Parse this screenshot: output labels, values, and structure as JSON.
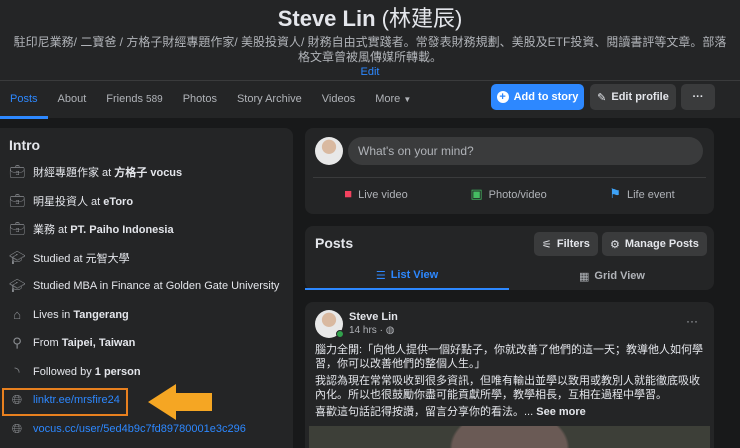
{
  "profile": {
    "name": "Steve Lin",
    "name_cn": "(林建辰)",
    "bio": "駐印尼業務/ 二寶爸 / 方格子財經專題作家/ 美股投資人/ 財務自由式實踐者。常發表財務規劃、美股及ETF投資、閱讀書評等文章。部落格文章曾被風傳媒所轉載。",
    "edit_label": "Edit"
  },
  "nav": {
    "tabs": [
      {
        "label": "Posts"
      },
      {
        "label": "About"
      },
      {
        "label": "Friends",
        "count": "589"
      },
      {
        "label": "Photos"
      },
      {
        "label": "Story Archive"
      },
      {
        "label": "Videos"
      },
      {
        "label": "More"
      }
    ],
    "add_story": "Add to story",
    "edit_profile": "Edit profile",
    "more_dots": "···"
  },
  "intro": {
    "title": "Intro",
    "items": [
      {
        "icon": "briefcase",
        "pre": "財經專題作家 at ",
        "bold": "方格子 vocus"
      },
      {
        "icon": "briefcase",
        "pre": "明星投資人 at ",
        "bold": "eToro"
      },
      {
        "icon": "briefcase",
        "pre": "業務 at ",
        "bold": "PT. Paiho Indonesia"
      },
      {
        "icon": "graduation-cap",
        "pre": "Studied at 元智大學",
        "bold": ""
      },
      {
        "icon": "graduation-cap",
        "pre": "Studied MBA in Finance at Golden Gate University",
        "bold": ""
      },
      {
        "icon": "home",
        "pre": "Lives in ",
        "bold": "Tangerang"
      },
      {
        "icon": "location-pin",
        "pre": "From ",
        "bold": "Taipei, Taiwan"
      },
      {
        "icon": "rss",
        "pre": "Followed by ",
        "bold": "1 person"
      }
    ],
    "links": [
      "linktr.ee/mrsfire24",
      "vocus.cc/user/5ed4b9c7fd89780001e3c296"
    ]
  },
  "composer": {
    "placeholder": "What's on your mind?",
    "actions": [
      "Live video",
      "Photo/video",
      "Life event"
    ]
  },
  "posts_header": {
    "title": "Posts",
    "filters": "Filters",
    "manage": "Manage Posts",
    "list_view": "List View",
    "grid_view": "Grid View"
  },
  "post": {
    "author": "Steve Lin",
    "time": "14 hrs ·",
    "paragraphs": [
      "腦力全開:「向他人提供一個好點子，你就改善了他們的這一天；教導他人如何學習，你可以改善他們的整個人生。」",
      "我認為現在常常吸收到很多資訊，但唯有輸出並學以致用或教別人就能徹底吸收內化。所以也很鼓勵你盡可能貢獻所學，教學相長，互相在過程中學習。",
      "喜歡這句話記得按讚，留言分享你的看法。..."
    ],
    "see_more": "See more",
    "menu": "···"
  },
  "colors": {
    "accent": "#2d88ff",
    "highlight": "#e8801f",
    "arrow": "#f5a623"
  }
}
